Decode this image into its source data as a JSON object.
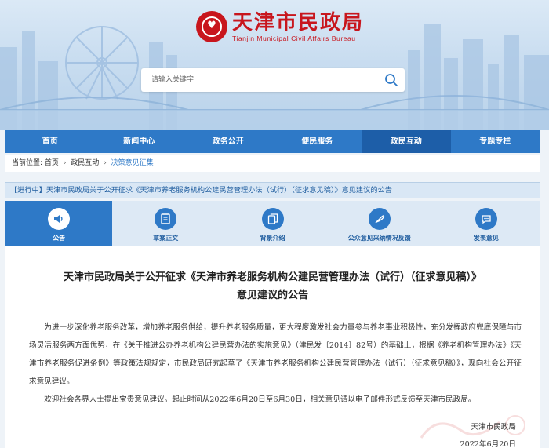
{
  "header": {
    "logo_cn": "天津市民政局",
    "logo_en": "Tianjin Municipal Civil Affairs Bureau",
    "search_placeholder": "请输入关键字"
  },
  "nav": {
    "items": [
      "首页",
      "新闻中心",
      "政务公开",
      "便民服务",
      "政民互动",
      "专题专栏"
    ],
    "active": "政民互动"
  },
  "breadcrumb": {
    "prefix": "当前位置:",
    "items": [
      "首页",
      "政民互动",
      "决策意见征集"
    ]
  },
  "notice": {
    "text": "【进行中】天津市民政局关于公开征求《天津市养老服务机构公建民营管理办法（试行）（征求意见稿）》意见建议的公告"
  },
  "tabs": {
    "items": [
      {
        "label": "公告",
        "icon": "speaker-icon"
      },
      {
        "label": "草案正文",
        "icon": "document-icon"
      },
      {
        "label": "背景介绍",
        "icon": "files-icon"
      },
      {
        "label": "公众意见采纳情况反馈",
        "icon": "feather-icon"
      },
      {
        "label": "发表意见",
        "icon": "chat-bubble-icon"
      }
    ],
    "active": "公告"
  },
  "article": {
    "title_line1": "天津市民政局关于公开征求《天津市养老服务机构公建民营管理办法（试行）（征求意见稿）》",
    "title_line2": "意见建议的公告",
    "paragraphs": [
      "为进一步深化养老服务改革，增加养老服务供给，提升养老服务质量，更大程度激发社会力量参与养老事业积极性，充分发挥政府兜底保障与市场灵活服务两方面优势，在《关于推进公办养老机构公建民营办法的实施意见》（津民发〔2014〕82号）的基础上，根据《养老机构管理办法》《天津市养老服务促进条例》等政策法规规定，市民政局研究起草了《天津市养老服务机构公建民营管理办法（试行）（征求意见稿）》，现向社会公开征求意见建议。",
      "欢迎社会各界人士提出宝贵意见建议。起止时间从2022年6月20日至6月30日，相关意见请以电子邮件形式反馈至天津市民政局。"
    ],
    "sign_org": "天津市民政局",
    "sign_date": "2022年6月20日"
  },
  "colors": {
    "brand_red": "#c8161d",
    "nav_blue": "#2e79c7",
    "nav_active": "#1d5ea8"
  }
}
